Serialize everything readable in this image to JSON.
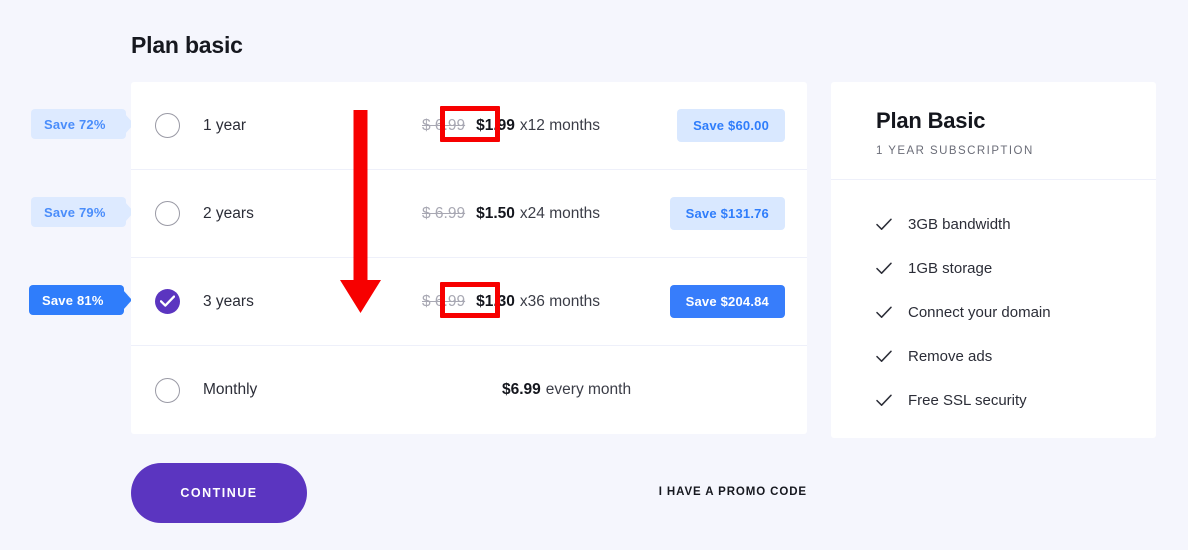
{
  "page": {
    "title": "Plan basic",
    "background_color": "#f5f6fd"
  },
  "plans": [
    {
      "id": "1-year",
      "label": "1 year",
      "selected": false,
      "old_price": "$ 6.99",
      "new_price": "$1.99",
      "term": "x12 months",
      "save_label": "Save $60.00",
      "save_emphasis": false,
      "percent_tag": "Save 72%",
      "percent_emphasis": false
    },
    {
      "id": "2-years",
      "label": "2 years",
      "selected": false,
      "old_price": "$ 6.99",
      "new_price": "$1.50",
      "term": "x24 months",
      "save_label": "Save $131.76",
      "save_emphasis": false,
      "percent_tag": "Save 79%",
      "percent_emphasis": false
    },
    {
      "id": "3-years",
      "label": "3 years",
      "selected": true,
      "old_price": "$ 6.99",
      "new_price": "$1.30",
      "term": "x36 months",
      "save_label": "Save $204.84",
      "save_emphasis": true,
      "percent_tag": "Save 81%",
      "percent_emphasis": true
    },
    {
      "id": "monthly",
      "label": "Monthly",
      "selected": false,
      "old_price": "",
      "new_price": "$6.99",
      "term": "every month",
      "save_label": "",
      "save_emphasis": false,
      "percent_tag": "",
      "percent_emphasis": false
    }
  ],
  "summary": {
    "title": "Plan Basic",
    "subtitle": "1 YEAR SUBSCRIPTION",
    "features": [
      "3GB bandwidth",
      "1GB storage",
      "Connect your domain",
      "Remove ads",
      "Free SSL security"
    ]
  },
  "footer": {
    "continue_label": "CONTINUE",
    "promo_label": "I HAVE A PROMO CODE"
  },
  "annotations": {
    "arrow_color": "#f70000",
    "highlight_color": "#f70000",
    "highlighted_prices": [
      "$1.99",
      "$1.30"
    ]
  },
  "colors": {
    "accent_purple": "#5b35c0",
    "accent_blue": "#2f7dfb",
    "badge_blue_bg": "#d9e8ff",
    "card_white": "#ffffff",
    "page_bg": "#f5f6fd"
  }
}
